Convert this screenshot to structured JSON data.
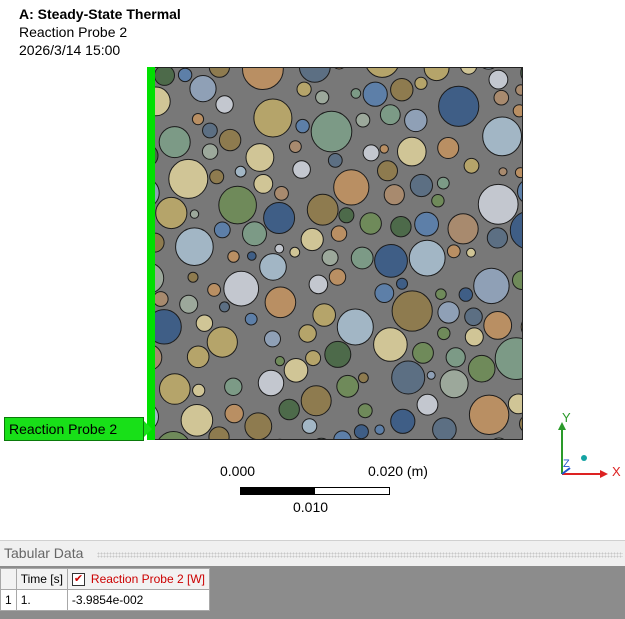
{
  "header": {
    "title": "A: Steady-State Thermal",
    "subtitle": "Reaction Probe 2",
    "timestamp": "2026/3/14 15:00"
  },
  "probe_label": "Reaction Probe 2",
  "scale_bar": {
    "left_value": "0.000",
    "right_value": "0.020 (m)",
    "middle_value": "0.010"
  },
  "triad": {
    "y": "Y",
    "x": "X",
    "z": "Z"
  },
  "tabular": {
    "title": "Tabular Data",
    "columns": [
      "Time [s]",
      "Reaction Probe 2 [W]"
    ],
    "column_checked": true,
    "rows": [
      {
        "index": "1",
        "time": "1.",
        "value": "-3.9854e-002"
      }
    ]
  },
  "colors": {
    "boundary_green": "#00e000",
    "matrix_grey": "#787878",
    "probe_header_red": "#cc0000"
  }
}
